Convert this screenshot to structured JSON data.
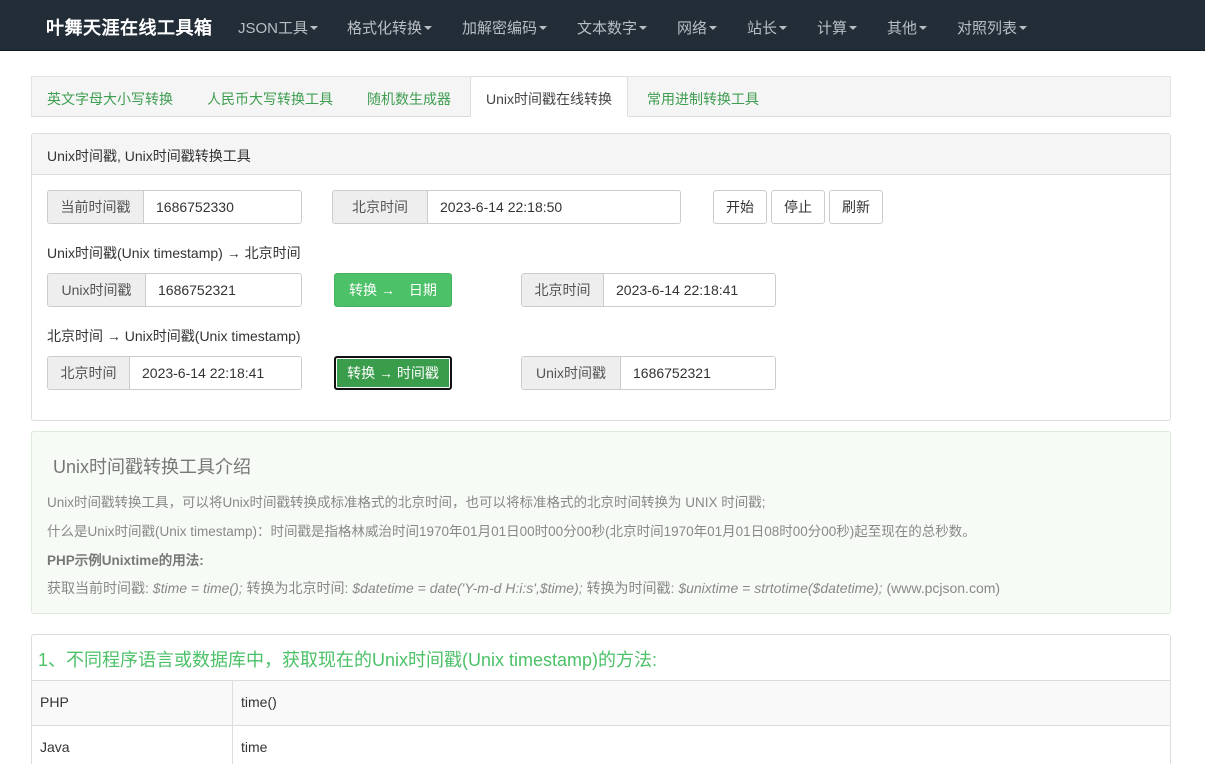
{
  "navbar": {
    "brand": "叶舞天涯在线工具箱",
    "items": [
      "JSON工具",
      "格式化转换",
      "加解密编码",
      "文本数字",
      "网络",
      "站长",
      "计算",
      "其他",
      "对照列表"
    ]
  },
  "tabs": [
    "英文字母大小写转换",
    "人民币大写转换工具",
    "随机数生成器",
    "Unix时间戳在线转换",
    "常用进制转换工具"
  ],
  "panel": {
    "heading": "Unix时间戳, Unix时间戳转换工具",
    "current": {
      "ts_label": "当前时间戳",
      "ts_value": "1686752330",
      "bj_label": "北京时间",
      "bj_value": "2023-6-14 22:18:50",
      "start": "开始",
      "stop": "停止",
      "refresh": "刷新"
    },
    "to_date": {
      "title": "Unix时间戳(Unix timestamp) → 北京时间",
      "in_label": "Unix时间戳",
      "in_value": "1686752321",
      "button": "转换 →　日期",
      "out_label": "北京时间",
      "out_value": "2023-6-14 22:18:41"
    },
    "to_ts": {
      "title": "北京时间 → Unix时间戳(Unix timestamp)",
      "in_label": "北京时间",
      "in_value": "2023-6-14 22:18:41",
      "button": "转换 → 时间戳",
      "out_label": "Unix时间戳",
      "out_value": "1686752321"
    }
  },
  "intro": {
    "title": "Unix时间戳转换工具介绍",
    "line1": "Unix时间戳转换工具，可以将Unix时间戳转换成标准格式的北京时间，也可以将标准格式的北京时间转换为 UNIX 时间戳;",
    "line2": "什么是Unix时间戳(Unix timestamp)：时间戳是指格林威治时间1970年01月01日00时00分00秒(北京时间1970年01月01日08时00分00秒)起至现在的总秒数。",
    "line3": "PHP示例Unixtime的用法:",
    "line4_a": "获取当前时间戳:",
    "line4_b": "$time = time();",
    "line4_c": "转换为北京时间:",
    "line4_d": "$datetime = date('Y-m-d H:i:s',$time);",
    "line4_e": "转换为时间戳:",
    "line4_f": "$unixtime = strtotime($datetime);",
    "line4_g": "(www.pcjson.com)"
  },
  "methods": {
    "title": "1、不同程序语言或数据库中，获取现在的Unix时间戳(Unix timestamp)的方法:",
    "rows": [
      {
        "lang": "PHP",
        "code": "time()"
      },
      {
        "lang": "Java",
        "code": "time"
      }
    ]
  }
}
